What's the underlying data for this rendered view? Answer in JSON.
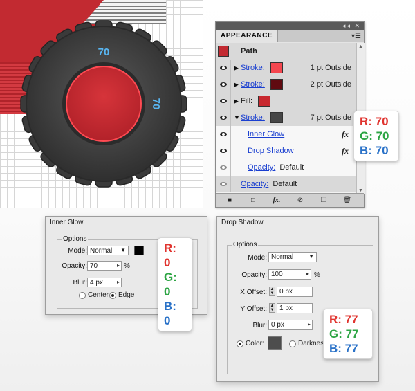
{
  "canvas": {
    "tire_numbers": [
      "70",
      "70"
    ],
    "colors": {
      "tire": "#464646",
      "hub": "#c8272d",
      "number": "#4fb0f0"
    }
  },
  "appearance": {
    "tab_label": "APPEARANCE",
    "header": {
      "label": "Path",
      "swatch": "#c22a31"
    },
    "rows": [
      {
        "kind": "stroke",
        "label": "Stroke:",
        "swatch": "#f4474f",
        "meta": "1 pt  Outside",
        "expanded": false
      },
      {
        "kind": "stroke",
        "label": "Stroke:",
        "swatch": "#600a10",
        "meta": "2 pt  Outside",
        "expanded": false
      },
      {
        "kind": "fill",
        "label": "Fill:",
        "swatch": "#c8282f",
        "meta": ""
      },
      {
        "kind": "stroke",
        "label": "Stroke:",
        "swatch": "#464646",
        "meta": "7 pt  Outside",
        "expanded": true
      },
      {
        "kind": "effect",
        "label": "Inner Glow",
        "fx": "fx"
      },
      {
        "kind": "effect",
        "label": "Drop Shadow",
        "fx": "fx"
      },
      {
        "kind": "opacity",
        "label": "Opacity:",
        "meta": "Default"
      },
      {
        "kind": "opacity-outer",
        "label": "Opacity:",
        "meta": "Default"
      }
    ]
  },
  "rgb_callouts": [
    {
      "r": "R: 70",
      "g": "G: 70",
      "b": "B: 70"
    },
    {
      "r": "R: 0",
      "g": "G: 0",
      "b": "B: 0"
    },
    {
      "r": "R: 77",
      "g": "G: 77",
      "b": "B: 77"
    }
  ],
  "inner_glow": {
    "title": "Inner Glow",
    "group_label": "Options",
    "mode_label": "Mode:",
    "mode_value": "Normal",
    "opacity_label": "Opacity:",
    "opacity_value": "70",
    "opacity_unit": "%",
    "blur_label": "Blur:",
    "blur_value": "4 px",
    "center_label": "Center",
    "edge_label": "Edge",
    "swatch": "#000000"
  },
  "drop_shadow": {
    "title": "Drop Shadow",
    "group_label": "Options",
    "mode_label": "Mode:",
    "mode_value": "Normal",
    "opacity_label": "Opacity:",
    "opacity_value": "100",
    "opacity_unit": "%",
    "xoff_label": "X Offset:",
    "xoff_value": "0 px",
    "yoff_label": "Y Offset:",
    "yoff_value": "1 px",
    "blur_label": "Blur:",
    "blur_value": "0 px",
    "color_label": "Color:",
    "darkness_label": "Darkness",
    "swatch": "#4d4d4d"
  }
}
